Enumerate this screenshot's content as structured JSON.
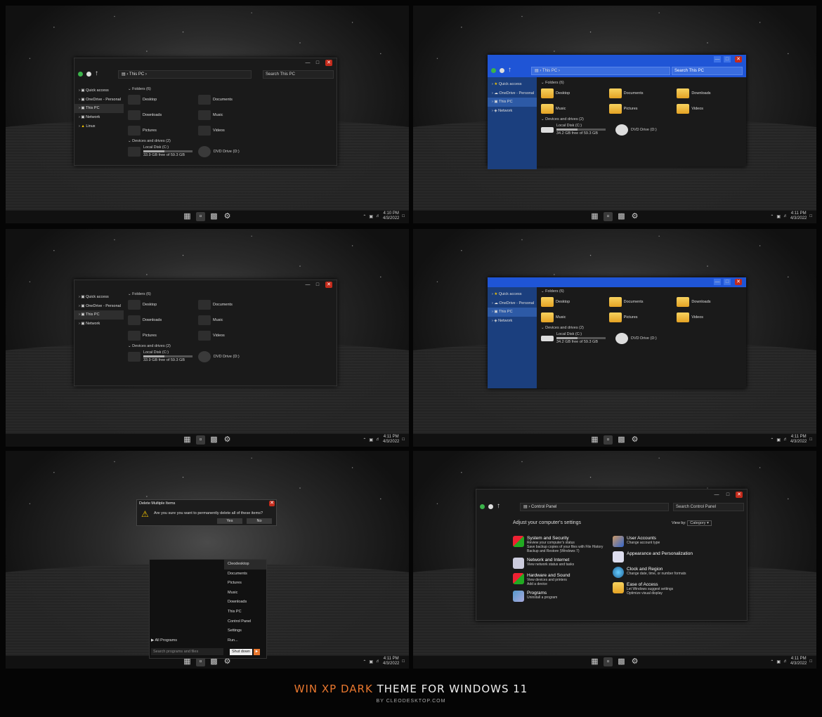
{
  "explorer": {
    "address": "This PC",
    "search_placeholder": "Search This PC",
    "back_label": "Back",
    "sidebar": [
      "Quick access",
      "OneDrive - Personal",
      "This PC",
      "Network",
      "Linux"
    ],
    "folders_header": "Folders (6)",
    "folders": [
      "Desktop",
      "Documents",
      "Downloads",
      "Music",
      "Pictures",
      "Videos"
    ],
    "devices_header": "Devices and drives (2)",
    "local_disk": "Local Disk (C:)",
    "local_disk_free_dark": "33.9 GB free of 59.3 GB",
    "local_disk_free_blue": "34.2 GB free of 59.3 GB",
    "local_disk_used_fraction": 0.43,
    "dvd": "DVD Drive (D:)"
  },
  "taskbar": {
    "time_a": "4:10 PM",
    "time_b": "4:11 PM",
    "date": "4/3/2022"
  },
  "dialog": {
    "title": "Delete Multiple Items",
    "message": "Are you sure you want to permanently delete all of these items?",
    "yes": "Yes",
    "no": "No"
  },
  "start_menu": {
    "items": [
      "Cleodesktop",
      "Documents",
      "Pictures",
      "Music",
      "Downloads",
      "This PC",
      "Control Panel",
      "Settings",
      "Run..."
    ],
    "all_programs": "All Programs",
    "search_placeholder": "Search programs and files",
    "shutdown": "Shut down"
  },
  "control_panel": {
    "address": "Control Panel",
    "search_placeholder": "Search Control Panel",
    "heading": "Adjust your computer's settings",
    "view_by_label": "View by:",
    "view_by_value": "Category",
    "left": [
      {
        "title": "System and Security",
        "subs": [
          "Review your computer's status",
          "Save backup copies of your files with File History",
          "Backup and Restore (Windows 7)"
        ]
      },
      {
        "title": "Network and Internet",
        "subs": [
          "View network status and tasks"
        ]
      },
      {
        "title": "Hardware and Sound",
        "subs": [
          "View devices and printers",
          "Add a device"
        ]
      },
      {
        "title": "Programs",
        "subs": [
          "Uninstall a program"
        ]
      }
    ],
    "right": [
      {
        "title": "User Accounts",
        "subs": [
          "Change account type"
        ]
      },
      {
        "title": "Appearance and Personalization",
        "subs": []
      },
      {
        "title": "Clock and Region",
        "subs": [
          "Change date, time, or number formats"
        ]
      },
      {
        "title": "Ease of Access",
        "subs": [
          "Let Windows suggest settings",
          "Optimize visual display"
        ]
      }
    ]
  },
  "footer": {
    "title_accent": "WIN XP DARK",
    "title_rest": "THEME FOR WINDOWS 11",
    "subtitle": "BY CLEODESKTOP.COM"
  },
  "colors": {
    "xp_blue": "#1f55d6",
    "xp_sidebar": "#1b3f7e",
    "close_red": "#c42b1c",
    "accent_orange": "#e8772e"
  }
}
